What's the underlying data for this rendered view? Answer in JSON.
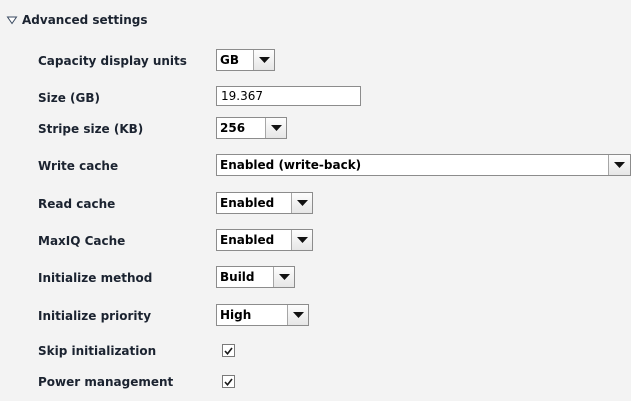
{
  "section": {
    "title": "Advanced settings",
    "expanded": true,
    "toggle_icon": "triangle-down-icon"
  },
  "fields": {
    "capacity_units": {
      "label": "Capacity display units",
      "value": "GB"
    },
    "size": {
      "label": "Size (GB)",
      "value": "19.367"
    },
    "stripe_size": {
      "label": "Stripe size (KB)",
      "value": "256"
    },
    "write_cache": {
      "label": "Write cache",
      "value": "Enabled (write-back)"
    },
    "read_cache": {
      "label": "Read cache",
      "value": "Enabled"
    },
    "maxiq_cache": {
      "label": "MaxIQ Cache",
      "value": "Enabled"
    },
    "init_method": {
      "label": "Initialize method",
      "value": "Build"
    },
    "init_priority": {
      "label": "Initialize priority",
      "value": "High"
    },
    "skip_init": {
      "label": "Skip initialization",
      "checked": true
    },
    "power_mgmt": {
      "label": "Power management",
      "checked": true
    }
  },
  "colors": {
    "panel_bg": "#f3f3f3",
    "label_text": "#1b2330",
    "border": "#8c8c8c"
  }
}
